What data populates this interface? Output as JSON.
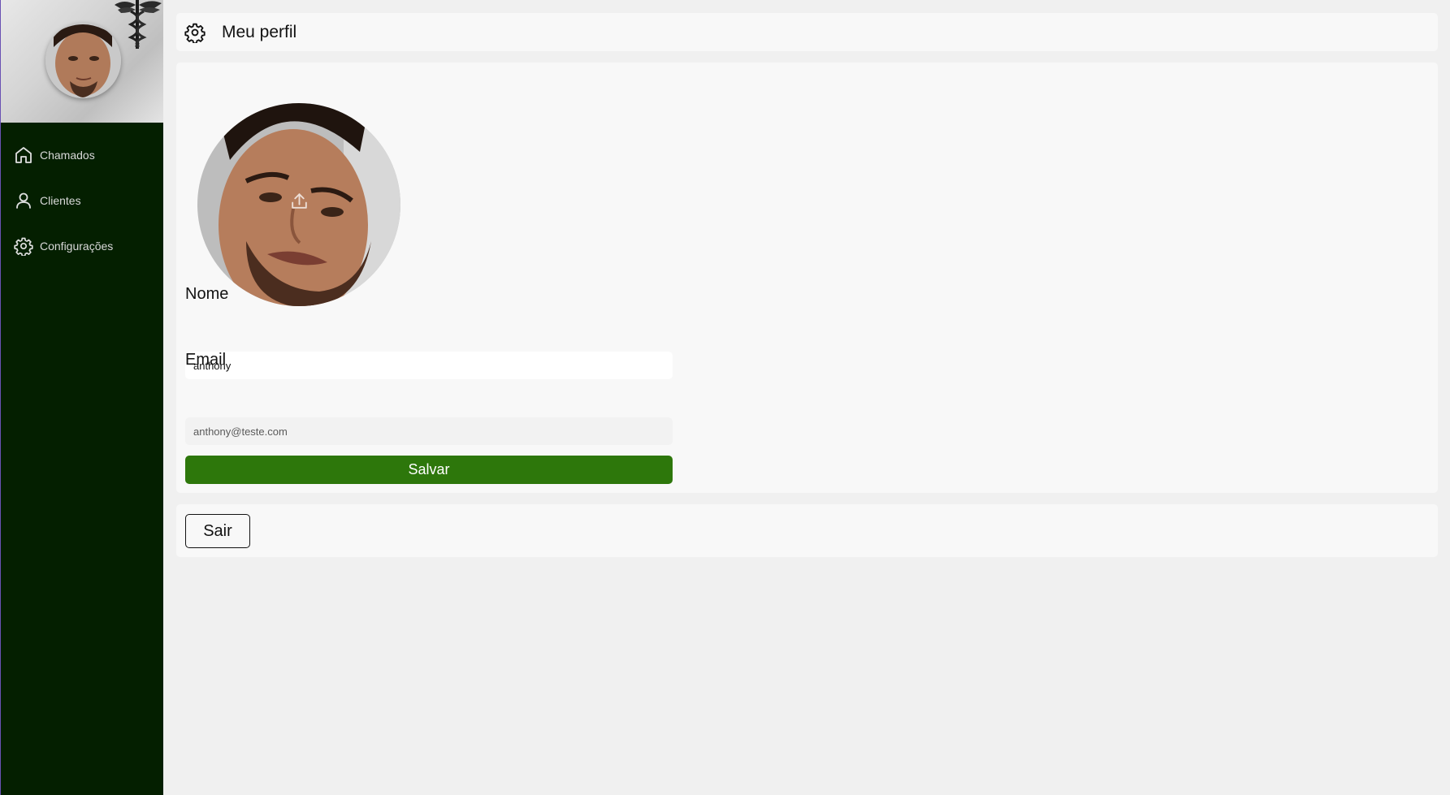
{
  "sidebar": {
    "items": [
      {
        "label": "Chamados",
        "icon": "home-icon"
      },
      {
        "label": "Clientes",
        "icon": "user-icon"
      },
      {
        "label": "Configurações",
        "icon": "gear-icon"
      }
    ]
  },
  "header": {
    "title": "Meu perfil",
    "icon": "gear-icon"
  },
  "profile": {
    "avatar_upload_icon": "upload-icon",
    "name_label": "Nome",
    "name_value": "anthony",
    "email_label": "Email",
    "email_value": "anthony@teste.com",
    "save_label": "Salvar"
  },
  "logout": {
    "label": "Sair"
  },
  "colors": {
    "sidebar_bg": "#041f00",
    "save_button": "#2d770b",
    "page_bg": "#f0f0f0",
    "card_bg": "#f8f8f8"
  }
}
